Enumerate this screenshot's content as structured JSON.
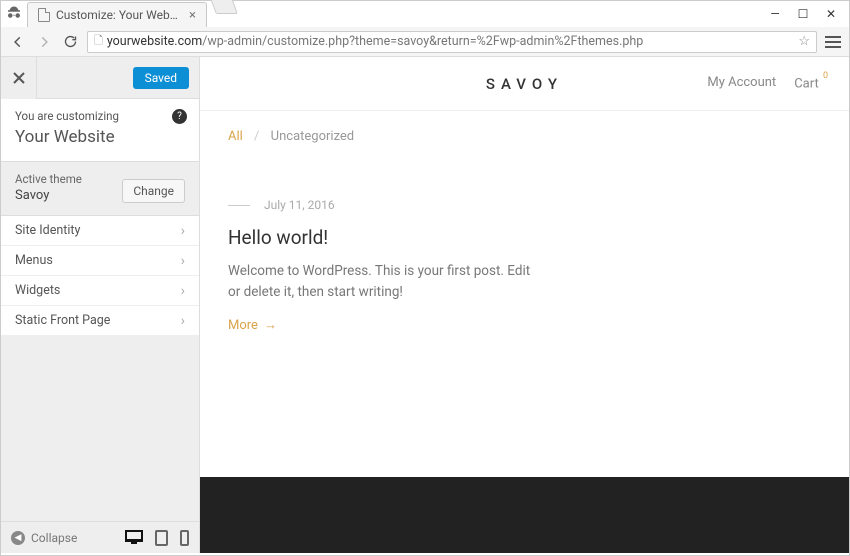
{
  "window_controls": {
    "minimize": "—",
    "maximize": "☐",
    "close": "✕"
  },
  "tab": {
    "title": "Customize: Your Website"
  },
  "url": {
    "host": "yourwebsite.com",
    "path": "/wp-admin/customize.php?theme=savoy&return=%2Fwp-admin%2Fthemes.php"
  },
  "customizer": {
    "saved_label": "Saved",
    "help_text": "You are customizing",
    "site_name": "Your Website",
    "active_theme_label": "Active theme",
    "active_theme_name": "Savoy",
    "change_label": "Change",
    "panels": [
      {
        "label": "Site Identity"
      },
      {
        "label": "Menus"
      },
      {
        "label": "Widgets"
      },
      {
        "label": "Static Front Page"
      }
    ],
    "collapse_label": "Collapse"
  },
  "preview": {
    "brand": "SAVOY",
    "my_account": "My Account",
    "cart_label": "Cart",
    "cart_count": "0",
    "crumb_all": "All",
    "crumb_sep": "/",
    "crumb_current": "Uncategorized",
    "post": {
      "date": "July 11, 2016",
      "title": "Hello world!",
      "excerpt": "Welcome to WordPress. This is your first post. Edit or delete it, then start writing!",
      "more": "More",
      "arrow": "→"
    }
  }
}
